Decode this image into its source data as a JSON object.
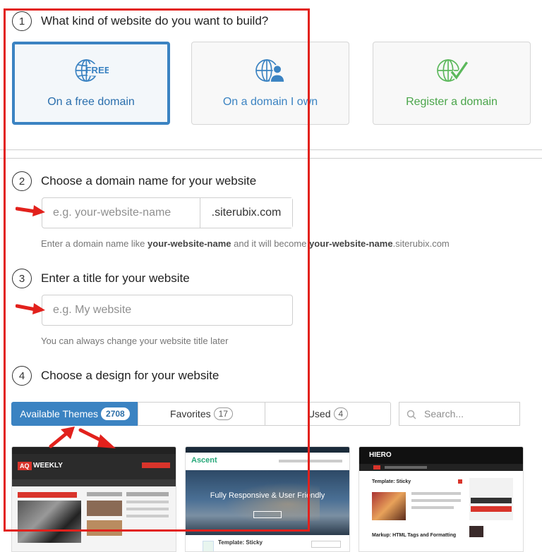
{
  "step1": {
    "number": "1",
    "title": "What kind of website do you want to build?"
  },
  "domain_options": [
    {
      "label": "On a free domain",
      "icon": "globe-free-icon",
      "icon_text": "FREE",
      "selected": true
    },
    {
      "label": "On a domain I own",
      "icon": "globe-user-icon",
      "selected": false
    },
    {
      "label": "Register a domain",
      "icon": "globe-check-icon",
      "selected": false
    }
  ],
  "step2": {
    "number": "2",
    "title": "Choose a domain name for your website",
    "placeholder": "e.g. your-website-name",
    "suffix": ".siterubix.com",
    "help_prefix": "Enter a domain name like ",
    "help_bold1": "your-website-name",
    "help_middle": " and it will become ",
    "help_bold2": "your-website-name",
    "help_suffix": ".siterubix.com"
  },
  "step3": {
    "number": "3",
    "title": "Enter a title for your website",
    "placeholder": "e.g. My website",
    "help": "You can always change your website title later"
  },
  "step4": {
    "number": "4",
    "title": "Choose a design for your website"
  },
  "tabs": [
    {
      "label": "Available Themes",
      "count": "2708",
      "active": true
    },
    {
      "label": "Favorites",
      "count": "17",
      "active": false
    },
    {
      "label": "Used",
      "count": "4",
      "active": false
    }
  ],
  "search": {
    "placeholder": "Search..."
  },
  "themes": [
    {
      "logo_badge": "AQ",
      "logo": "WEEKLY"
    },
    {
      "logo": "Ascent",
      "hero": "Fully Responsive & User Friendly",
      "post": "Template: Sticky"
    },
    {
      "logo": "HIERO",
      "post1": "Template: Sticky",
      "post2": "Markup: HTML Tags and Formatting"
    }
  ],
  "colors": {
    "accent": "#3b83c2",
    "highlight": "#e2211c",
    "check_green": "#5cb85c",
    "success_text": "#4aa54a"
  }
}
